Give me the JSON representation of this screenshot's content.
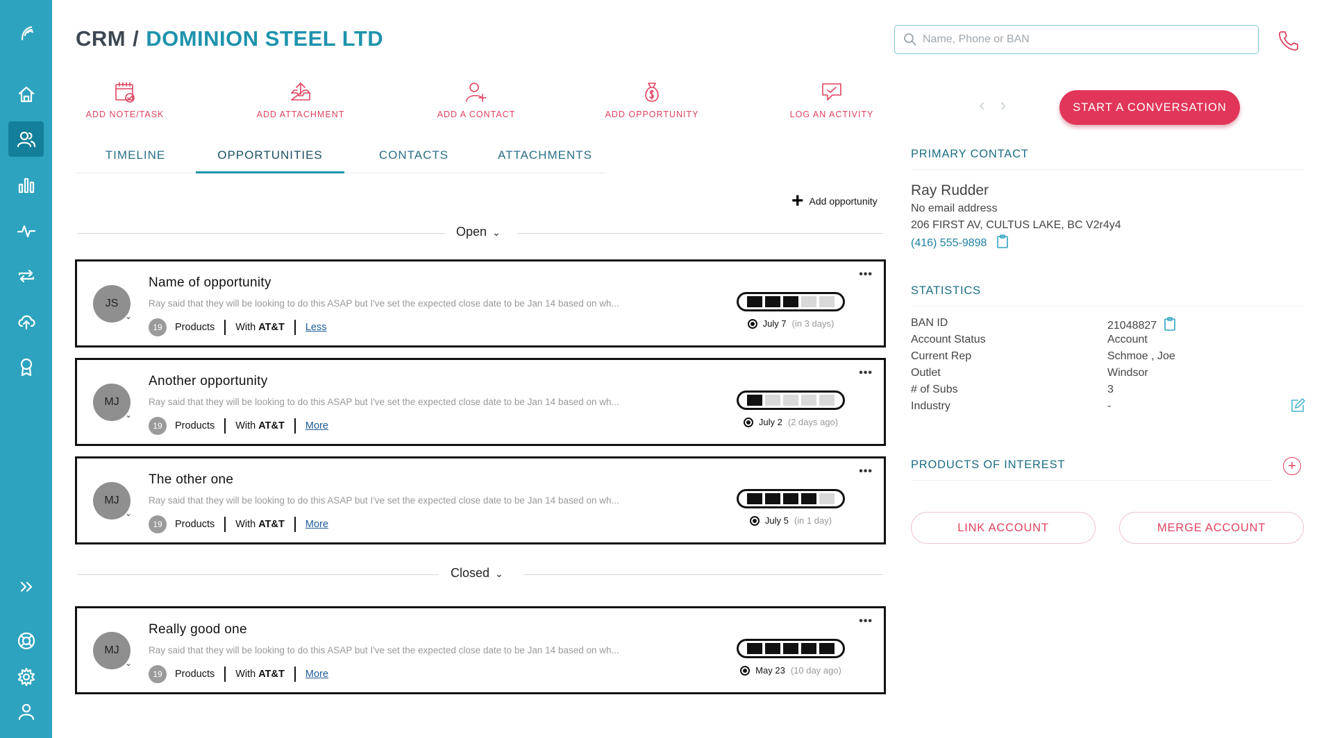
{
  "sidebar": {
    "icons": [
      "logo-icon",
      "home-icon",
      "users-icon",
      "bar-chart-icon",
      "activity-icon",
      "sync-icon",
      "cloud-upload-icon",
      "award-icon",
      "expand-icon",
      "help-icon",
      "settings-icon",
      "profile-icon"
    ],
    "active": "users-icon",
    "accent_color": "#2ea3bf"
  },
  "header": {
    "crumb_root": "CRM",
    "crumb_sep": "/",
    "company": "DOMINION STEEL LTD",
    "search_placeholder": "Name, Phone or BAN"
  },
  "actions": [
    {
      "label": "ADD NOTE/TASK",
      "icon": "calendar-check-icon"
    },
    {
      "label": "ADD ATTACHMENT",
      "icon": "upload-tray-icon"
    },
    {
      "label": "ADD A CONTACT",
      "icon": "add-user-icon"
    },
    {
      "label": "ADD OPPORTUNITY",
      "icon": "money-bag-icon"
    },
    {
      "label": "LOG AN ACTIVITY",
      "icon": "chat-icon"
    }
  ],
  "tabs": [
    {
      "label": "TIMELINE",
      "active": false
    },
    {
      "label": "OPPORTUNITIES",
      "active": true
    },
    {
      "label": "CONTACTS",
      "active": false
    },
    {
      "label": "ATTACHMENTS",
      "active": false
    }
  ],
  "add_opportunity_label": "Add opportunity",
  "sections": {
    "open": "Open",
    "closed": "Closed"
  },
  "opportunities": [
    {
      "initials": "JS",
      "title": "Name of opportunity",
      "description": "Ray said that they will be looking to do this ASAP but I've set the expected close date to be Jan 14 based on wh...",
      "count": "19",
      "products": "Products",
      "with_prefix": "With",
      "carrier": "AT&T",
      "link": "Less",
      "progress_filled": 3,
      "progress_total": 5,
      "date": "July 7",
      "relative": "(in 3 days)"
    },
    {
      "initials": "MJ",
      "title": "Another opportunity",
      "description": "Ray said that they will be looking to do this ASAP but I've set the expected close date to be Jan 14 based on wh...",
      "count": "19",
      "products": "Products",
      "with_prefix": "With",
      "carrier": "AT&T",
      "link": "More",
      "progress_filled": 1,
      "progress_total": 5,
      "date": "July 2",
      "relative": "(2 days ago)"
    },
    {
      "initials": "MJ",
      "title": "The other one",
      "description": "Ray said that they will be looking to do this ASAP but I've set the expected close date to be Jan 14 based on wh...",
      "count": "19",
      "products": "Products",
      "with_prefix": "With",
      "carrier": "AT&T",
      "link": "More",
      "progress_filled": 4,
      "progress_total": 5,
      "date": "July 5",
      "relative": "(in 1 day)"
    },
    {
      "initials": "MJ",
      "title": "Really good one",
      "description": "Ray said that they will be looking to do this ASAP but I've set the expected close date to be Jan 14 based on wh...",
      "count": "19",
      "products": "Products",
      "with_prefix": "With",
      "carrier": "AT&T",
      "link": "More",
      "progress_filled": 5,
      "progress_total": 5,
      "date": "May 23",
      "relative": "(10 day ago)"
    }
  ],
  "right_panel": {
    "start_conversation": "START A CONVERSATION",
    "primary_contact_heading": "PRIMARY CONTACT",
    "contact": {
      "name": "Ray Rudder",
      "email": "No email address",
      "address": "206 FIRST AV, CULTUS LAKE, BC V2r4y4",
      "phone": "(416) 555-9898"
    },
    "statistics_heading": "STATISTICS",
    "statistics": [
      {
        "key": "BAN ID",
        "value": "21048827"
      },
      {
        "key": "Account Status",
        "value": "Account"
      },
      {
        "key": "Current Rep",
        "value": "Schmoe , Joe"
      },
      {
        "key": "Outlet",
        "value": "Windsor"
      },
      {
        "key": "# of Subs",
        "value": "3"
      },
      {
        "key": "Industry",
        "value": "-"
      }
    ],
    "products_heading": "PRODUCTS OF INTEREST",
    "link_account": "LINK ACCOUNT",
    "merge_account": "MERGE ACCOUNT",
    "accent_color": "#e0425f"
  }
}
